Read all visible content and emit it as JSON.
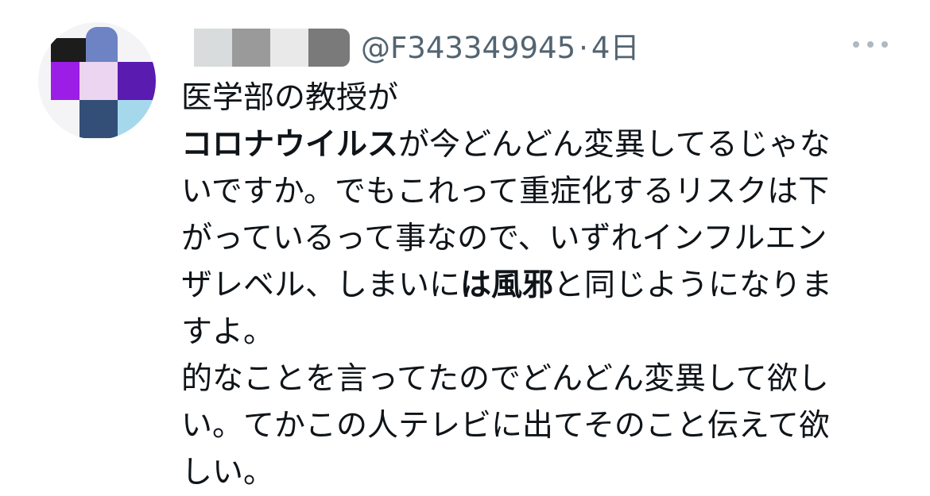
{
  "header": {
    "handle": "@F343349945",
    "separator": "·",
    "timestamp": "4日",
    "more_icon": "ellipsis-icon"
  },
  "tweet": {
    "lines": [
      {
        "segments": [
          {
            "text": "医学部の教授が",
            "bold": false
          }
        ]
      },
      {
        "segments": [
          {
            "text": "コロナウイルス",
            "bold": true
          },
          {
            "text": "が今どんどん変異してるじゃな",
            "bold": false
          }
        ]
      },
      {
        "segments": [
          {
            "text": "いですか。でもこれって重症化するリスクは下",
            "bold": false
          }
        ]
      },
      {
        "segments": [
          {
            "text": "がっているって事なので、いずれインフルエン",
            "bold": false
          }
        ]
      },
      {
        "segments": [
          {
            "text": "ザレベル、しまいに",
            "bold": false
          },
          {
            "text": "は風邪",
            "bold": true
          },
          {
            "text": "と同じようになりま",
            "bold": false
          }
        ]
      },
      {
        "segments": [
          {
            "text": "すよ。",
            "bold": false
          }
        ]
      },
      {
        "segments": [
          {
            "text": "的なことを言ってたのでどんどん変異して欲し",
            "bold": false
          }
        ]
      },
      {
        "segments": [
          {
            "text": "い。てかこの人テレビに出てそのこと伝えて欲",
            "bold": false
          }
        ]
      },
      {
        "segments": [
          {
            "text": "しい。",
            "bold": false
          }
        ]
      }
    ]
  },
  "colors": {
    "text": "#0f1419",
    "secondary": "#536471",
    "avatar_pixels": [
      "#9a1ee6",
      "#ecd5f0",
      "#5a1bb0",
      "#334f78",
      "#a6d8ec",
      "#6d83c4",
      "#1c1c1c"
    ],
    "name_blocks": [
      "#d9dcdc",
      "#9a9a9a",
      "#e9e9e9",
      "#7a7a7a"
    ]
  }
}
